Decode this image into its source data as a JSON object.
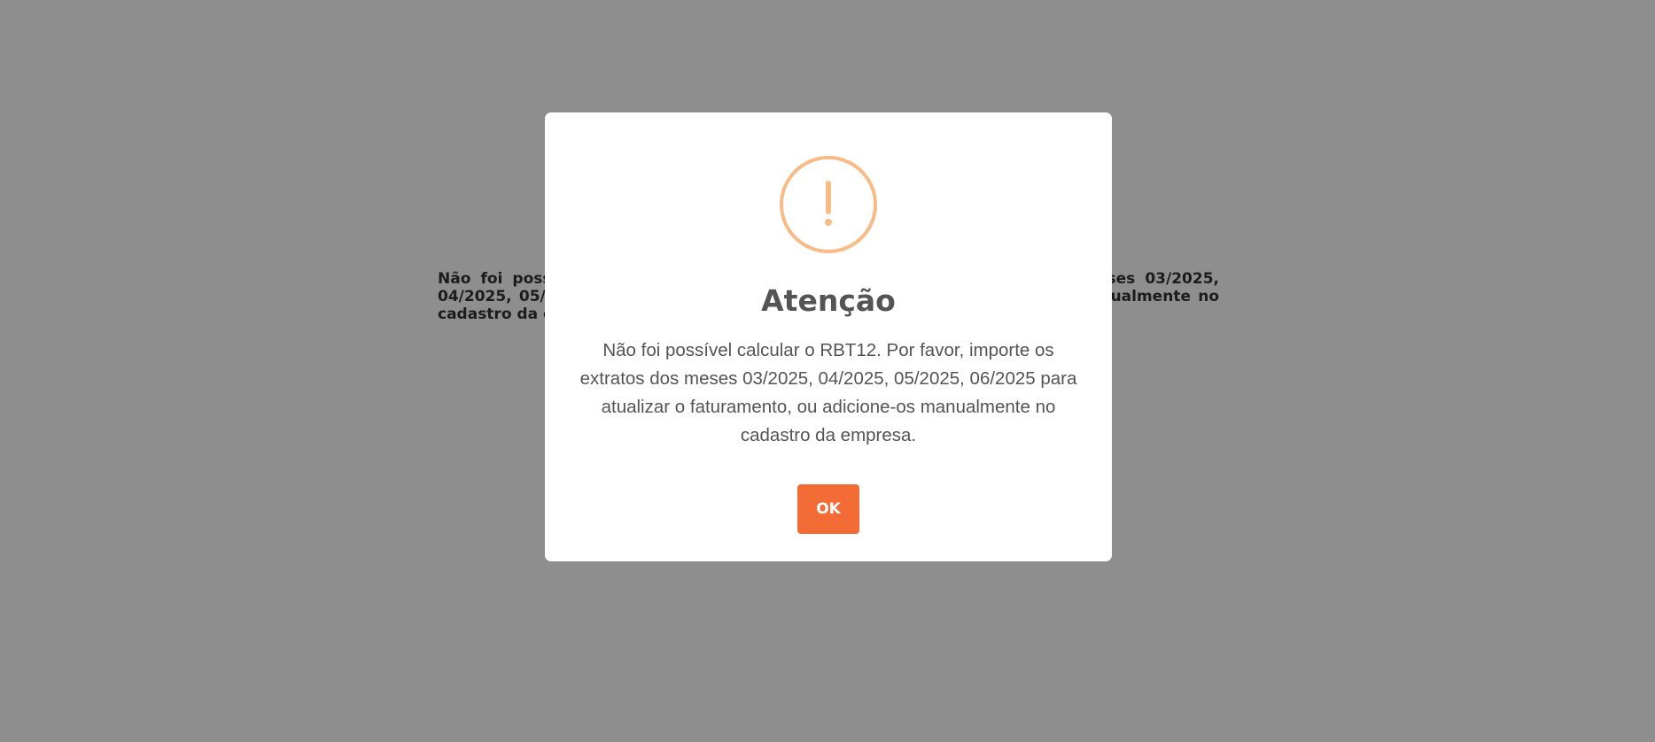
{
  "background": {
    "message": "Não foi possível calcular o RBT12. Por favor, importe os extratos dos meses 03/2025, 04/2025, 05/2025, 06/2025 para atualizar o faturamento, ou adicione-os manualmente no cadastro da empresa."
  },
  "modal": {
    "icon": "warning-exclamation-icon",
    "title": "Atenção",
    "message": "Não foi possível calcular o RBT12. Por favor, importe os extratos dos meses 03/2025, 04/2025, 05/2025, 06/2025 para atualizar o faturamento, ou adicione-os manualmente no cadastro da empresa.",
    "confirm_label": "OK"
  },
  "colors": {
    "overlay": "#8e8e8e",
    "icon": "#f8bb86",
    "button": "#f36c35",
    "text": "#545454"
  }
}
